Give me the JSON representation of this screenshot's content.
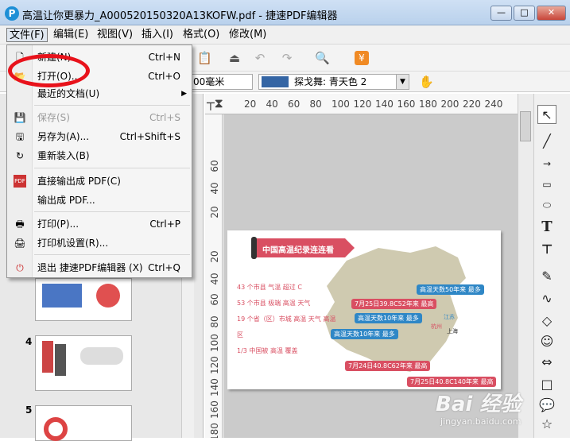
{
  "window": {
    "title": "高温让你更暴力_A000520150320A13KOFW.pdf - 捷速PDF编辑器",
    "logo_letter": "P",
    "min": "—",
    "max": "□",
    "close": "✕"
  },
  "menubar": [
    "文件(F)",
    "编辑(E)",
    "视图(V)",
    "插入(I)",
    "格式(O)",
    "修改(M)"
  ],
  "toolbar2": {
    "line_width": "00毫米",
    "color_name": "探戈舞: 青天色 2"
  },
  "ruler": {
    "top": [
      "20",
      "40",
      "60",
      "80",
      "100",
      "120",
      "140",
      "160",
      "180",
      "200",
      "220",
      "240"
    ],
    "left": [
      "60",
      "40",
      "20",
      "20",
      "40",
      "60",
      "80",
      "100",
      "120",
      "140",
      "160",
      "180"
    ]
  },
  "file_menu": [
    {
      "label": "新建(N)",
      "shortcut": "Ctrl+N",
      "enabled": true,
      "icon": "new-doc-icon"
    },
    {
      "label": "打开(O)...",
      "shortcut": "Ctrl+O",
      "enabled": true,
      "icon": "open-folder-icon"
    },
    {
      "label": "最近的文档(U)",
      "shortcut": "",
      "enabled": true,
      "icon": "",
      "submenu": true
    },
    {
      "label": "保存(S)",
      "shortcut": "Ctrl+S",
      "enabled": false,
      "icon": "save-icon"
    },
    {
      "label": "另存为(A)...",
      "shortcut": "Ctrl+Shift+S",
      "enabled": true,
      "icon": "save-as-icon"
    },
    {
      "label": "重新装入(B)",
      "shortcut": "",
      "enabled": true,
      "icon": "reload-icon"
    },
    {
      "label": "直接输出成 PDF(C)",
      "shortcut": "",
      "enabled": true,
      "icon": "pdf-icon"
    },
    {
      "label": "输出成 PDF...",
      "shortcut": "",
      "enabled": true,
      "icon": ""
    },
    {
      "label": "打印(P)...",
      "shortcut": "Ctrl+P",
      "enabled": true,
      "icon": "print-icon"
    },
    {
      "label": "打印机设置(R)...",
      "shortcut": "",
      "enabled": true,
      "icon": "printer-setup-icon"
    },
    {
      "label": "退出 捷速PDF编辑器 (X)",
      "shortcut": "Ctrl+Q",
      "enabled": true,
      "icon": "exit-icon"
    }
  ],
  "thumbnails": [
    {
      "num": ""
    },
    {
      "num": "4"
    },
    {
      "num": "5"
    }
  ],
  "document": {
    "banner": "中国高温纪录连连看",
    "stats": [
      "43 个市县 气温 超过 C",
      "53 个市县 极端 高温 天气",
      "19 个省（区）市城 高温 天气 高温区",
      "1/3 中国被 高温 覆盖"
    ],
    "callouts": [
      "高温天数50年来 最多",
      "7月25日39.8C52年来 最高",
      "高温天数10年来 最多",
      "高温天数10年来 最多",
      "7月24日40.8C62年来 最高",
      "7月25日40.8C140年来 最高"
    ],
    "places": [
      "杭州",
      "上海",
      "江苏"
    ]
  },
  "watermark": {
    "brand": "Bai 经验",
    "url": "jingyan.baidu.com"
  },
  "colors": {
    "accent_red": "#e8121b",
    "banner_red": "#d94f62",
    "callout_blue": "#2f87c6",
    "map_land": "#cfcab0",
    "swatch_blue": "#3465a4"
  }
}
